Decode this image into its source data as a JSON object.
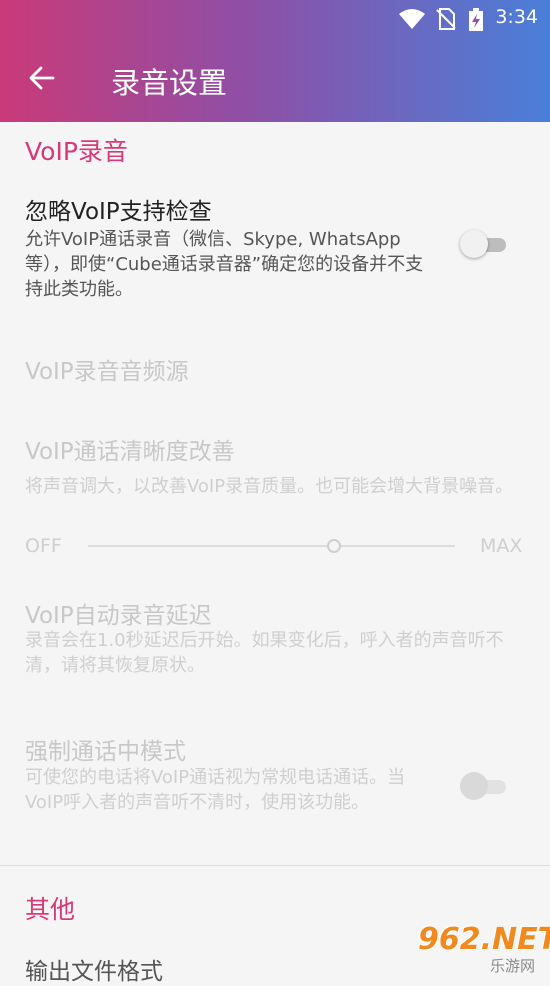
{
  "status_bar": {
    "time": "3:34",
    "icons": [
      "wifi-icon",
      "no-sim-icon",
      "battery-charging-icon"
    ]
  },
  "toolbar": {
    "back_icon": "arrow-left-icon",
    "title": "录音设置"
  },
  "voip_section": {
    "header": "VoIP录音",
    "ignore_check": {
      "title": "忽略VoIP支持检查",
      "summary": "允许VoIP通话录音（微信、Skype, WhatsApp等），即使“Cube通话录音器”确定您的设备并不支持此类功能。",
      "switch_on": false
    },
    "audio_source": {
      "title": "VoIP录音音频源"
    },
    "clarity": {
      "title": "VoIP通话清晰度改善",
      "summary": "将声音调大，以改善VoIP录音质量。也可能会增大背景噪音。",
      "min_label": "OFF",
      "max_label": "MAX",
      "level": 0.67
    },
    "auto_delay": {
      "title": "VoIP自动录音延迟",
      "summary": "录音会在1.0秒延迟后开始。如果变化后，呼入者的声音听不清，请将其恢复原状。"
    },
    "force_mode": {
      "title": "强制通话中模式",
      "summary": "可使您的电话将VoIP通话视为常规电话通话。当VoIP呼入者的声音听不清时，使用该功能。",
      "switch_on": false
    }
  },
  "other_section": {
    "header": "其他",
    "output_format": {
      "title": "输出文件格式"
    }
  },
  "watermark": {
    "main": "962.NET",
    "sub": "乐游网"
  },
  "colors": {
    "accent": "#d63a78",
    "appbar_start": "#c93a78",
    "appbar_end": "#4a7fd9"
  }
}
